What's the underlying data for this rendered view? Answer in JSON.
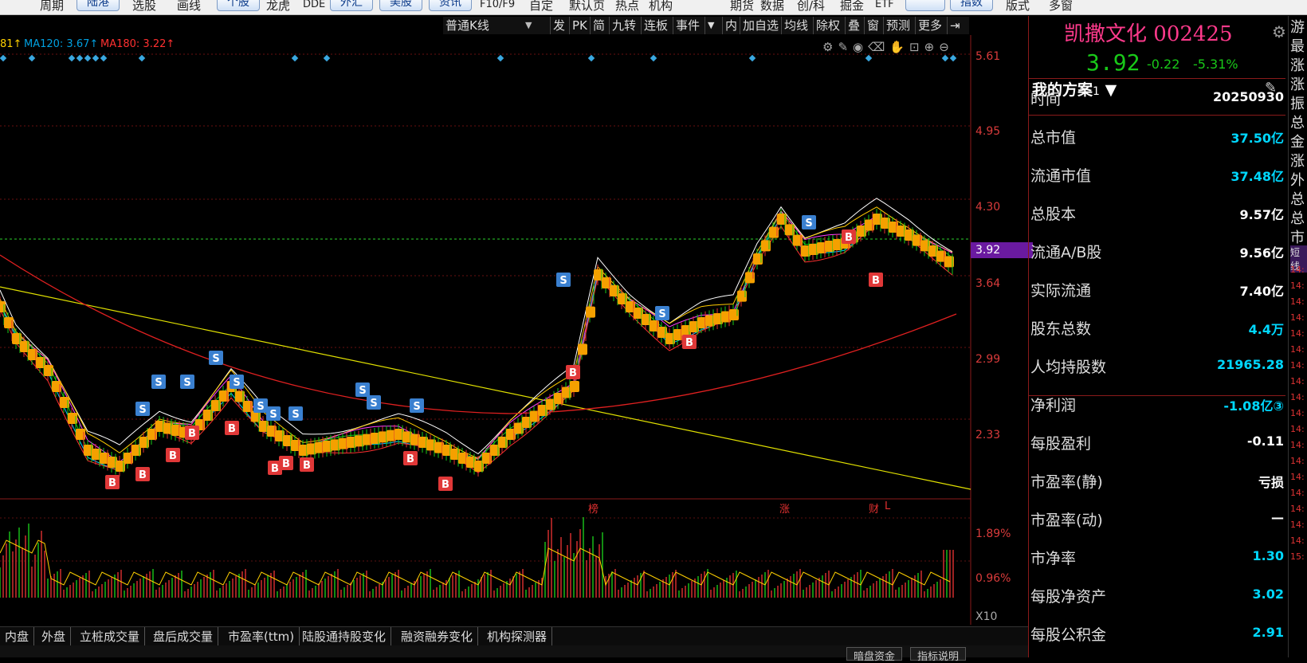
{
  "topbar": {
    "items": [
      "周期",
      "选股",
      "画线",
      "龙虎",
      "DDE",
      "F10/F9",
      "自定",
      "默认页",
      "热点",
      "机构",
      "期货",
      "数据",
      "创/科",
      "掘金",
      "ETF",
      "版式",
      "多窗"
    ],
    "buttons": [
      "陆港",
      "个股",
      "外汇",
      "美股",
      "资讯",
      "",
      "指数"
    ]
  },
  "chartbar": {
    "kline_type": "普通K线",
    "items": [
      "发",
      "PK",
      "简",
      "九转",
      "连板",
      "事件",
      "内",
      "加自选",
      "均线",
      "除权",
      "叠",
      "窗",
      "预测",
      "更多"
    ]
  },
  "legend": {
    "ma_prev": "81↑",
    "ma120": "MA120: 3.67↑",
    "ma180": "MA180: 3.22↑"
  },
  "price_axis": [
    "5.61",
    "4.95",
    "4.30",
    "3.92",
    "3.64",
    "2.99",
    "2.33"
  ],
  "current_price_tag": "3.92",
  "volume_axis": [
    "1.89%",
    "0.96%",
    "X10"
  ],
  "event_markers": [
    "榜",
    "涨",
    "财",
    "L"
  ],
  "stock": {
    "name": "凯撒文化",
    "code": "002425",
    "price": "3.92",
    "change": "-0.22",
    "change_pct": "-5.31%"
  },
  "plan": {
    "title": "我的方案",
    "index": "1"
  },
  "fundamentals": [
    {
      "label": "时间",
      "value": "20250930",
      "color": "#ffffff"
    },
    {
      "label": "总市值",
      "value": "37.50亿",
      "color": "#00d8ff"
    },
    {
      "label": "流通市值",
      "value": "37.48亿",
      "color": "#00d8ff"
    },
    {
      "label": "总股本",
      "value": "9.57亿",
      "color": "#ffffff"
    },
    {
      "label": "流通A/B股",
      "value": "9.56亿",
      "color": "#ffffff"
    },
    {
      "label": "实际流通",
      "value": "7.40亿",
      "color": "#ffffff"
    },
    {
      "label": "股东总数",
      "value": "4.4万",
      "color": "#00d8ff"
    },
    {
      "label": "人均持股数",
      "value": "21965.28",
      "color": "#00d8ff"
    },
    {
      "label": "净利润",
      "value": "-1.08亿③",
      "color": "#00d8ff"
    },
    {
      "label": "每股盈利",
      "value": "-0.11",
      "color": "#ffffff"
    },
    {
      "label": "市盈率(静)",
      "value": "亏损",
      "color": "#ffffff"
    },
    {
      "label": "市盈率(动)",
      "value": "—",
      "color": "#ffffff"
    },
    {
      "label": "市净率",
      "value": "1.30",
      "color": "#00d8ff"
    },
    {
      "label": "每股净资产",
      "value": "3.02",
      "color": "#00d8ff"
    },
    {
      "label": "每股公积金",
      "value": "2.91",
      "color": "#00d8ff"
    }
  ],
  "tabs": [
    "内盘",
    "外盘",
    "立桩成交量",
    "盘后成交量",
    "市盈率(ttm)",
    "陆股通持股变化",
    "融资融券变化",
    "机构探测器"
  ],
  "bottom_buttons": [
    "暗盘资金",
    "指标说明"
  ],
  "strip": {
    "chars": [
      "游",
      "最",
      "涨",
      "涨",
      "振",
      "总",
      "金",
      "涨",
      "外",
      "总",
      "总",
      "市"
    ],
    "tag": "短线",
    "times": [
      "14:",
      "14:",
      "14:",
      "14:",
      "14:",
      "14:",
      "14:",
      "14:",
      "14:",
      "14:",
      "14:",
      "14:",
      "14:",
      "14:",
      "14:",
      "14:",
      "14:",
      "14:",
      "15:"
    ]
  },
  "colors": {
    "red": "#e03030",
    "green": "#19c819",
    "cyan": "#00d8ff",
    "yellow": "#ffcc00",
    "orange": "#f5a000"
  }
}
